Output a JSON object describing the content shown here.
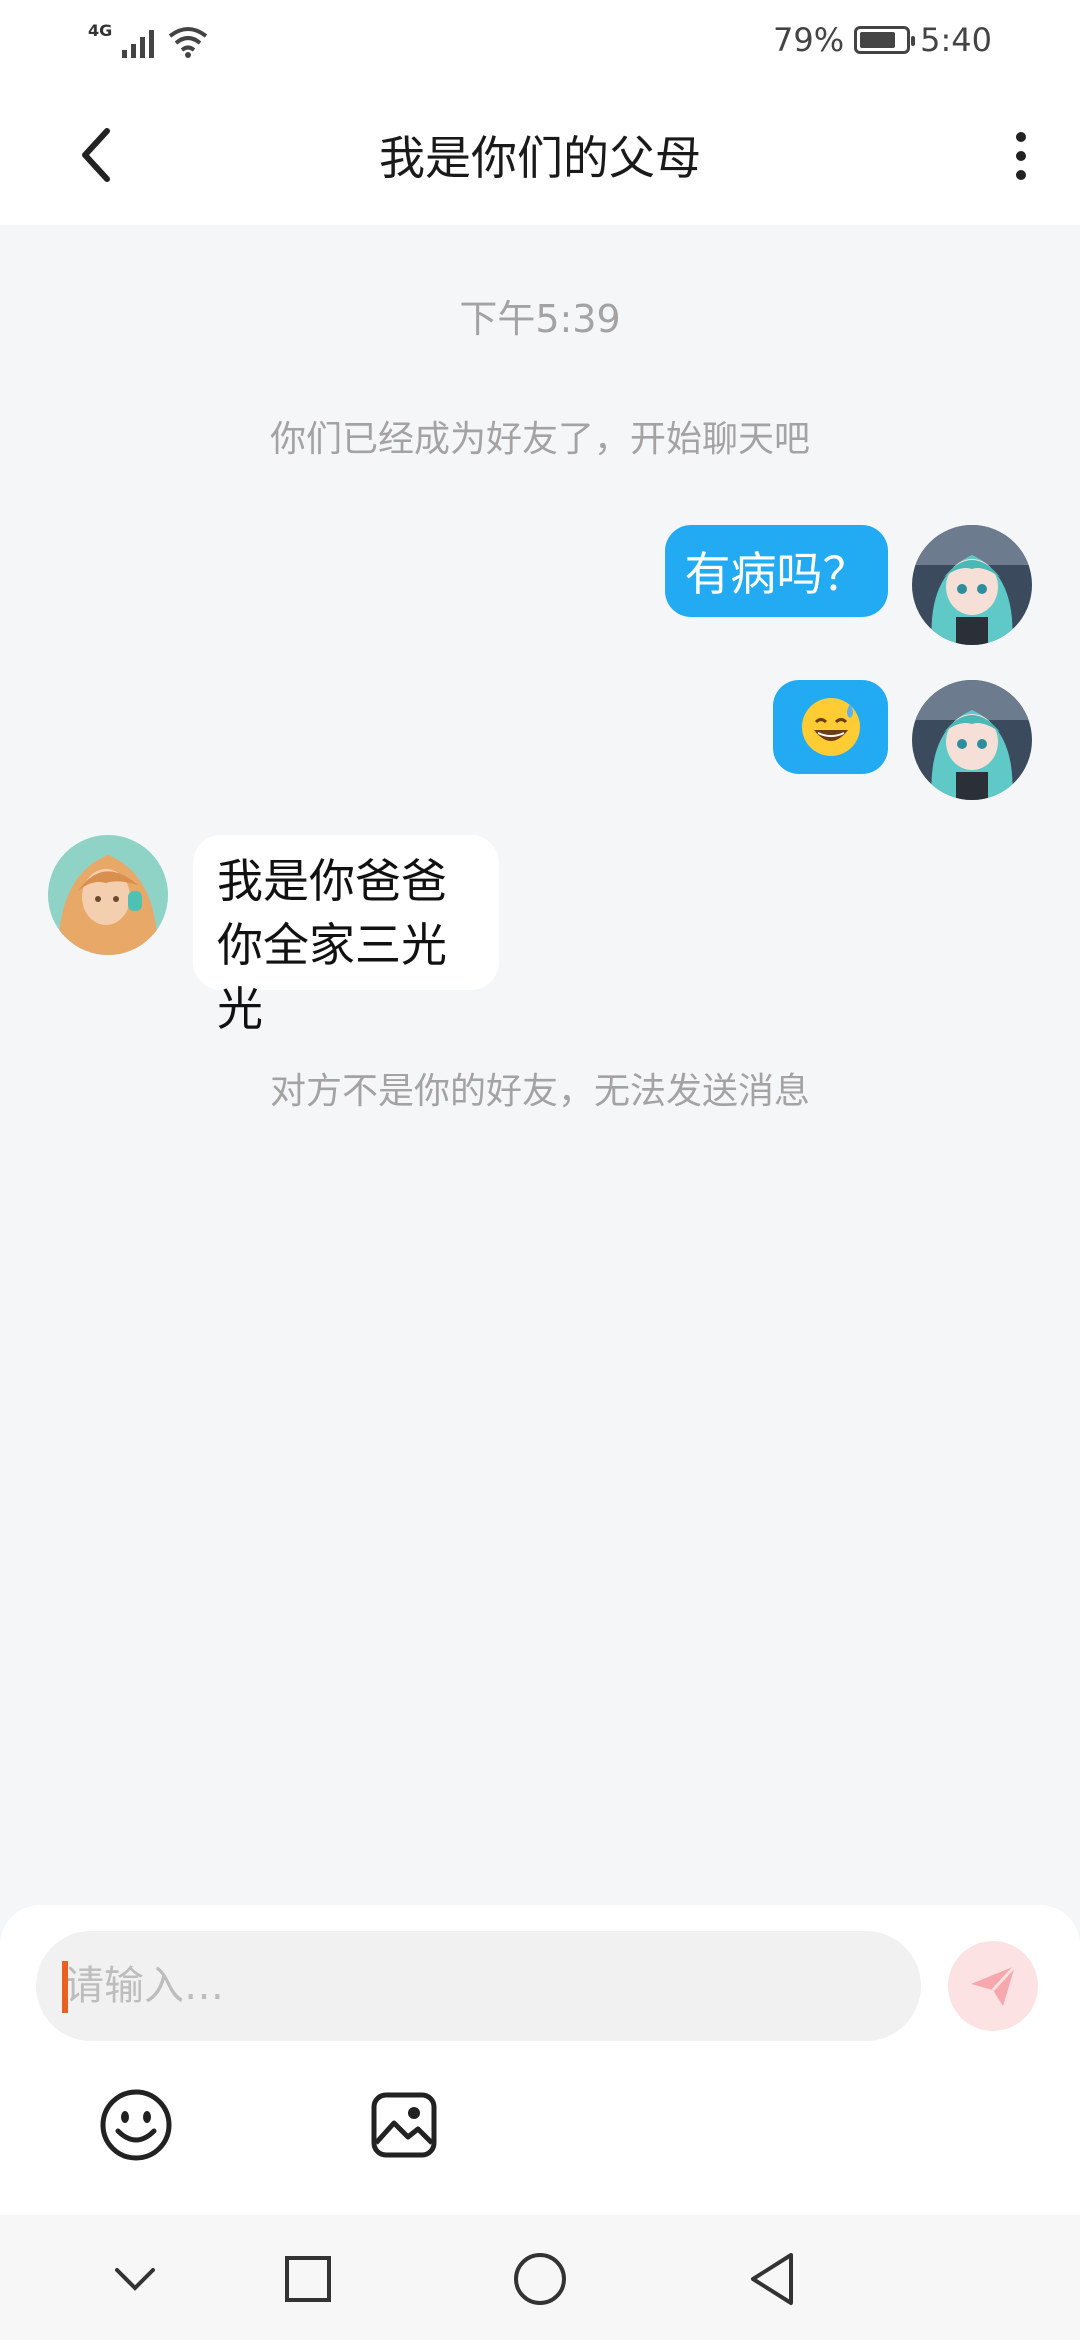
{
  "status_bar": {
    "network_type": "4G",
    "battery_percent_text": "79%",
    "battery_level": 0.79,
    "time": "5:40"
  },
  "header": {
    "title": "我是你们的父母"
  },
  "chat": {
    "timestamp": "下午5:39",
    "system_friend_notice": "你们已经成为好友了，开始聊天吧",
    "messages": [
      {
        "sender": "self",
        "text": "有病吗？"
      },
      {
        "sender": "self",
        "emoji": "😅"
      },
      {
        "sender": "other",
        "lines": [
          "我是你爸爸",
          "你全家三光光"
        ]
      }
    ],
    "system_not_friend_notice": "对方不是你的好友，无法发送消息"
  },
  "input": {
    "placeholder": "请输入…"
  },
  "colors": {
    "self_bubble": "#22aaf2",
    "other_bubble": "#ffffff",
    "send_button_bg": "#fde2e4",
    "send_icon": "#f7a8ad",
    "caret": "#e8611f"
  },
  "icons": {
    "back": "chevron-left-icon",
    "more": "more-vertical-icon",
    "send": "paper-plane-icon",
    "emoji": "smiley-icon",
    "image": "image-icon",
    "nav": [
      "chevron-down-icon",
      "square-icon",
      "circle-icon",
      "triangle-back-icon"
    ]
  }
}
